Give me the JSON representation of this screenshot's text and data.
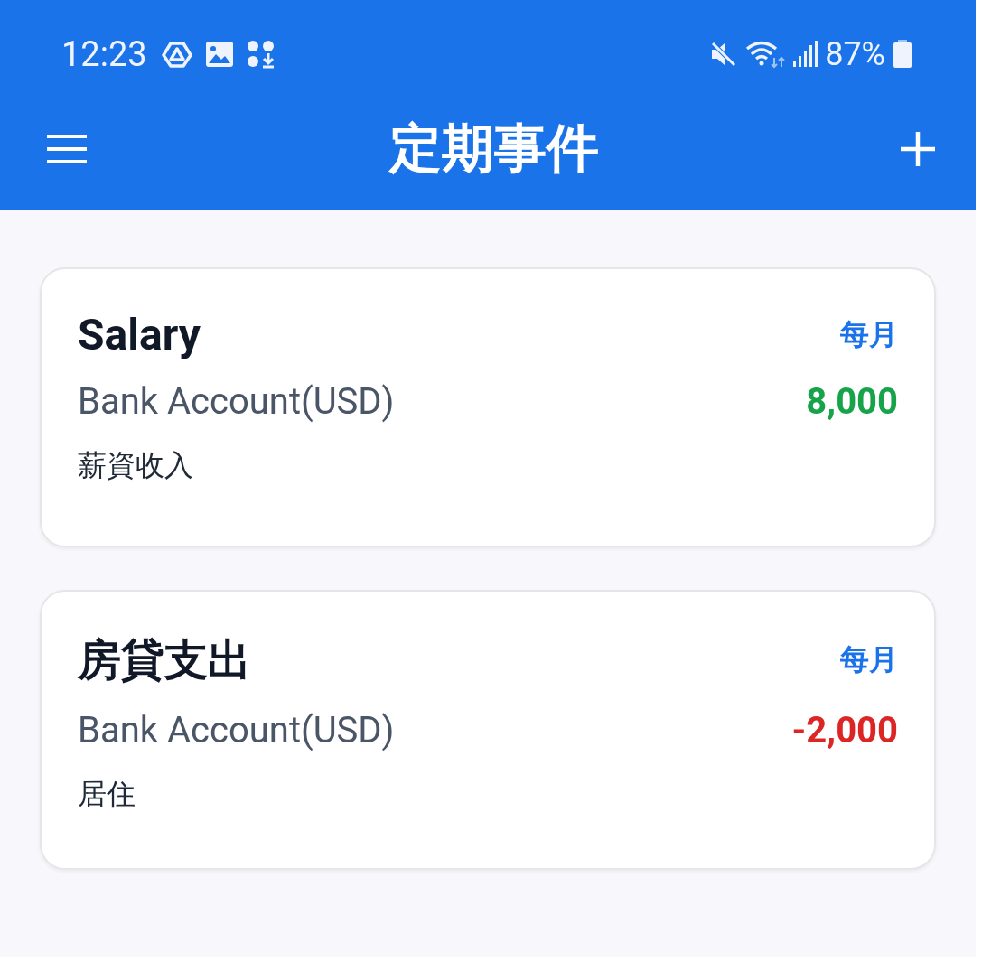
{
  "status_bar": {
    "time": "12:23",
    "battery": "87%"
  },
  "app_bar": {
    "title": "定期事件"
  },
  "events": [
    {
      "title": "Salary",
      "frequency": "每月",
      "account": "Bank Account(USD)",
      "amount": "8,000",
      "kind": "income",
      "category": "薪資收入"
    },
    {
      "title": "房貸支出",
      "frequency": "每月",
      "account": "Bank Account(USD)",
      "amount": "-2,000",
      "kind": "expense",
      "category": "居住"
    }
  ]
}
